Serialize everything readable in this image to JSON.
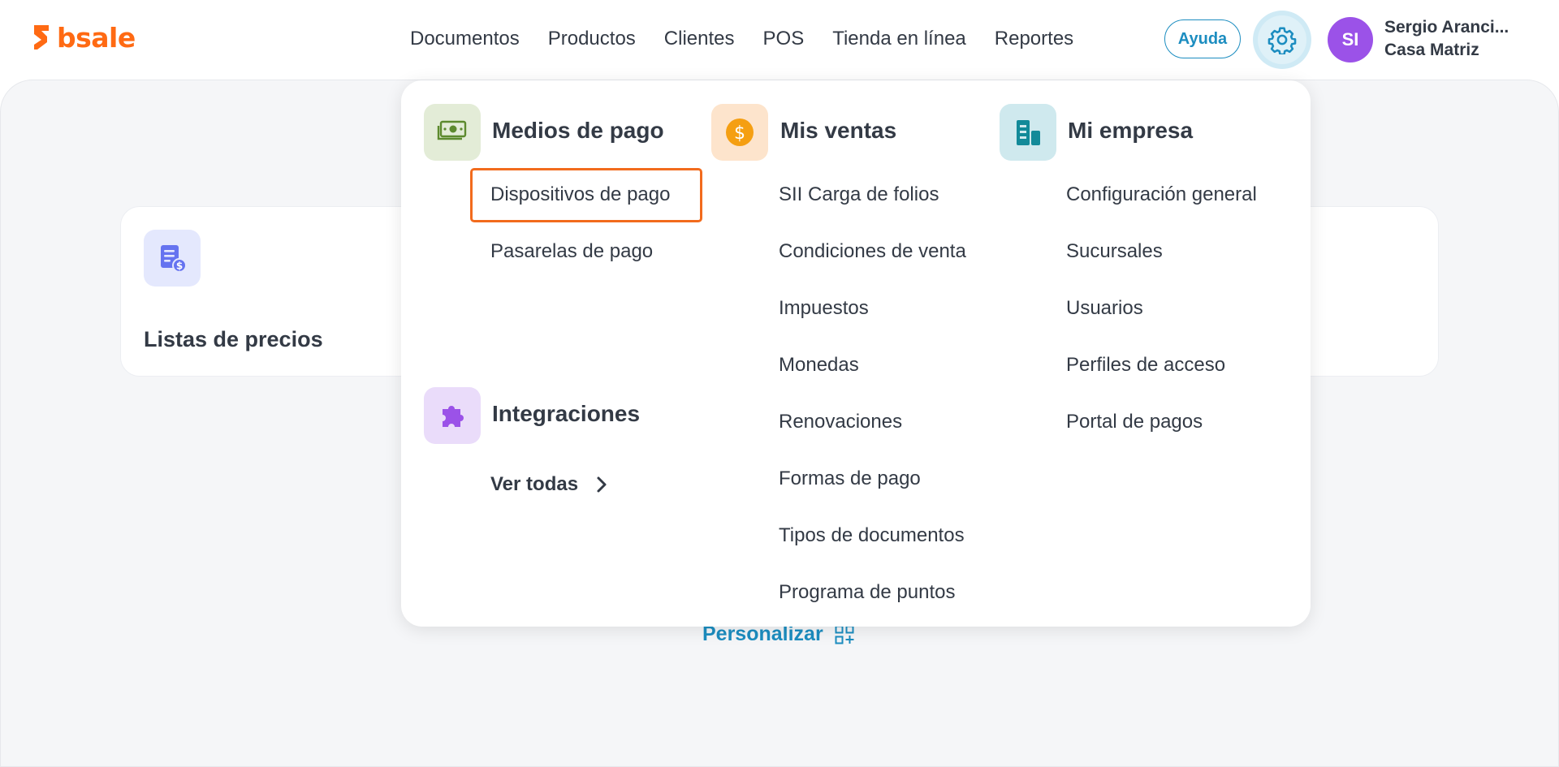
{
  "brand": {
    "logo_text": "bsale",
    "accent": "#ff6a13"
  },
  "nav": {
    "items": [
      "Documentos",
      "Productos",
      "Clientes",
      "POS",
      "Tienda en línea",
      "Reportes"
    ]
  },
  "header": {
    "help_label": "Ayuda",
    "settings_icon": "gear-icon",
    "avatar_initials": "SI",
    "user_name": "Sergio Aranci...",
    "user_branch": "Casa Matriz"
  },
  "main": {
    "card_title": "Listas de precios",
    "card_icon": "price-list-icon",
    "personalize_label": "Personalizar",
    "personalize_icon": "qr-add-icon"
  },
  "dropdown": {
    "medios_de_pago": {
      "title": "Medios de pago",
      "icon": "cash-icon",
      "links": [
        "Dispositivos de pago",
        "Pasarelas de pago"
      ],
      "highlighted": "Dispositivos de pago"
    },
    "integraciones": {
      "title": "Integraciones",
      "icon": "puzzle-icon",
      "link": "Ver todas"
    },
    "mis_ventas": {
      "title": "Mis ventas",
      "icon": "dollar-coin-icon",
      "links": [
        "SII Carga de folios",
        "Condiciones de venta",
        "Impuestos",
        "Monedas",
        "Renovaciones",
        "Formas de pago",
        "Tipos de documentos",
        "Programa de puntos"
      ]
    },
    "mi_empresa": {
      "title": "Mi empresa",
      "icon": "building-icon",
      "links": [
        "Configuración general",
        "Sucursales",
        "Usuarios",
        "Perfiles de acceso",
        "Portal de pagos"
      ]
    }
  },
  "colors": {
    "link_blue": "#1c8dc0",
    "highlight_border": "#f26b1d",
    "avatar_bg": "#9b52e8"
  }
}
